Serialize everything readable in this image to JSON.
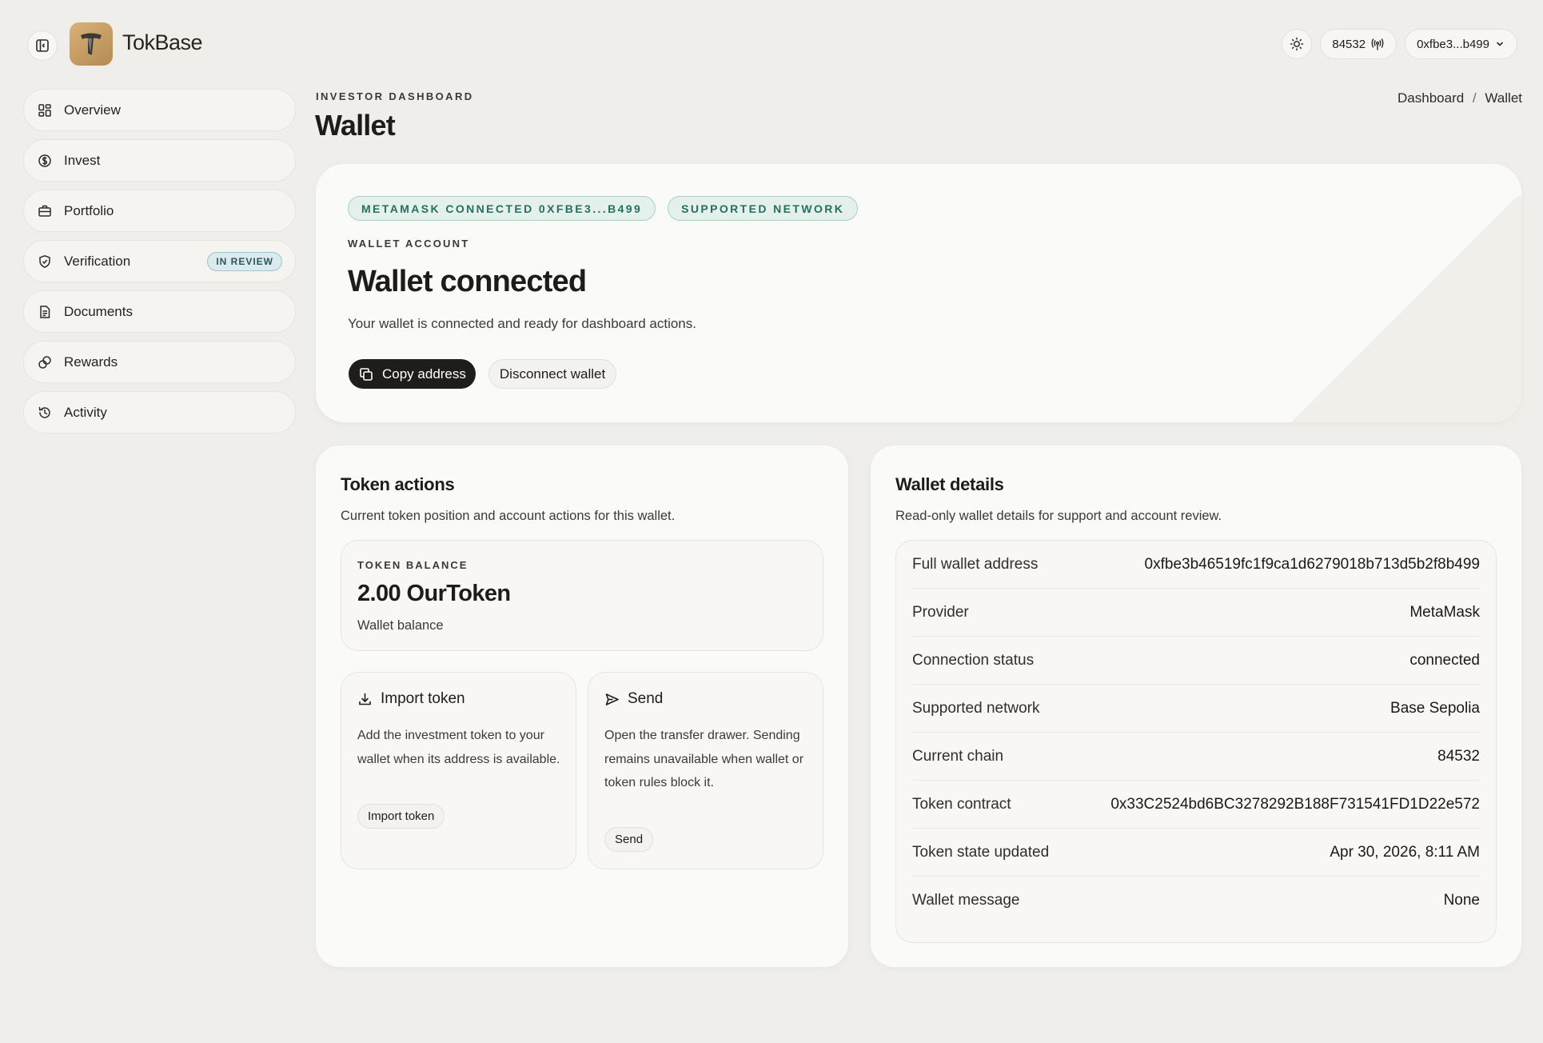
{
  "header": {
    "brand": "TokBase",
    "chain_id": "84532",
    "account_short": "0xfbe3...b499"
  },
  "sidebar": {
    "items": [
      {
        "label": "Overview",
        "icon": "grid-icon"
      },
      {
        "label": "Invest",
        "icon": "dollar-circle-icon"
      },
      {
        "label": "Portfolio",
        "icon": "briefcase-icon"
      },
      {
        "label": "Verification",
        "icon": "shield-icon",
        "badge": "IN REVIEW"
      },
      {
        "label": "Documents",
        "icon": "document-icon"
      },
      {
        "label": "Rewards",
        "icon": "rewards-icon"
      },
      {
        "label": "Activity",
        "icon": "history-icon"
      }
    ]
  },
  "page": {
    "eyebrow": "INVESTOR DASHBOARD",
    "title": "Wallet",
    "breadcrumb": [
      "Dashboard",
      "Wallet"
    ],
    "breadcrumb_sep": "/"
  },
  "hero": {
    "badges": [
      "METAMASK CONNECTED 0XFBE3...B499",
      "SUPPORTED NETWORK"
    ],
    "eyebrow": "WALLET ACCOUNT",
    "title": "Wallet connected",
    "description": "Your wallet is connected and ready for dashboard actions.",
    "copy_label": "Copy address",
    "disconnect_label": "Disconnect wallet"
  },
  "token_actions": {
    "title": "Token actions",
    "subtitle": "Current token position and account actions for this wallet.",
    "balance": {
      "eyebrow": "TOKEN BALANCE",
      "value": "2.00 OurToken",
      "caption": "Wallet balance"
    },
    "import": {
      "title": "Import token",
      "description": "Add the investment token to your wallet when its address is available.",
      "button": "Import token"
    },
    "send": {
      "title": "Send",
      "description": "Open the transfer drawer. Sending remains unavailable when wallet or token rules block it.",
      "button": "Send"
    }
  },
  "wallet_details": {
    "title": "Wallet details",
    "subtitle": "Read-only wallet details for support and account review.",
    "rows": [
      {
        "label": "Full wallet address",
        "value": "0xfbe3b46519fc1f9ca1d6279018b713d5b2f8b499"
      },
      {
        "label": "Provider",
        "value": "MetaMask"
      },
      {
        "label": "Connection status",
        "value": "connected"
      },
      {
        "label": "Supported network",
        "value": "Base Sepolia"
      },
      {
        "label": "Current chain",
        "value": "84532"
      },
      {
        "label": "Token contract",
        "value": "0x33C2524bd6BC3278292B188F731541FD1D22e572"
      },
      {
        "label": "Token state updated",
        "value": "Apr 30, 2026, 8:11 AM"
      },
      {
        "label": "Wallet message",
        "value": "None"
      }
    ]
  },
  "colors": {
    "accent_dark": "#1e1d1b",
    "tag_green": "#25705a",
    "review_badge": "#2c5560",
    "background": "#efeeeb"
  }
}
